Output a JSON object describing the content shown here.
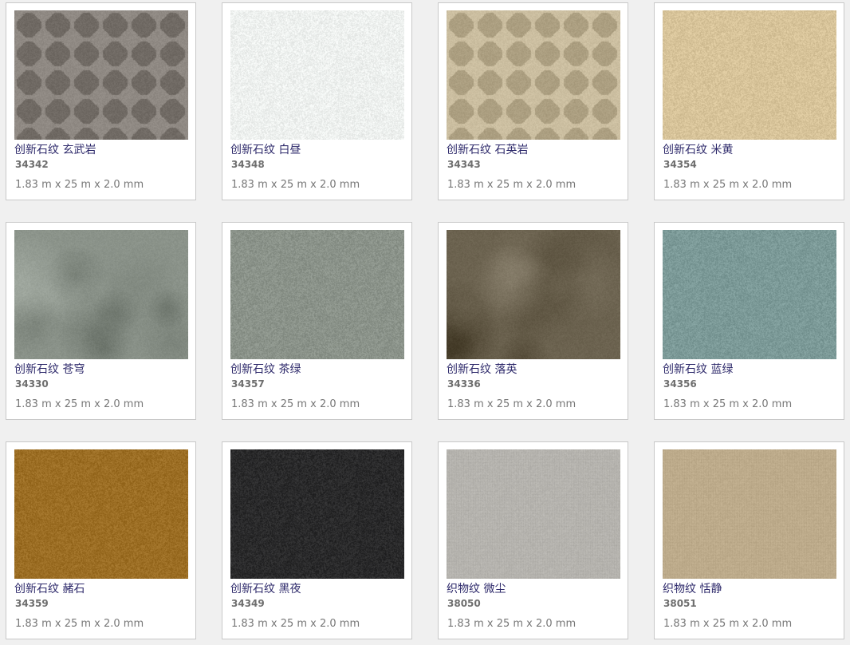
{
  "products": [
    {
      "name": "创新石纹 玄武岩",
      "code": "34342",
      "dims": "1.83 m x 25 m x 2.0 mm",
      "color": "#86807a",
      "pattern": "quatrefoil"
    },
    {
      "name": "创新石纹 白昼",
      "code": "34348",
      "dims": "1.83 m x 25 m x 2.0 mm",
      "color": "#eef1ef",
      "pattern": "speckle"
    },
    {
      "name": "创新石纹 石英岩",
      "code": "34343",
      "dims": "1.83 m x 25 m x 2.0 mm",
      "color": "#c2b597",
      "pattern": "quatrefoil"
    },
    {
      "name": "创新石纹 米黄",
      "code": "34354",
      "dims": "1.83 m x 25 m x 2.0 mm",
      "color": "#d8c49a",
      "pattern": "speckle"
    },
    {
      "name": "创新石纹 苍穹",
      "code": "34330",
      "dims": "1.83 m x 25 m x 2.0 mm",
      "color": "#8b938a",
      "pattern": "cloud"
    },
    {
      "name": "创新石纹 茶绿",
      "code": "34357",
      "dims": "1.83 m x 25 m x 2.0 mm",
      "color": "#8b938a",
      "pattern": "speckle"
    },
    {
      "name": "创新石纹 落英",
      "code": "34336",
      "dims": "1.83 m x 25 m x 2.0 mm",
      "color": "#6c6350",
      "pattern": "cloud"
    },
    {
      "name": "创新石纹 蓝绿",
      "code": "34356",
      "dims": "1.83 m x 25 m x 2.0 mm",
      "color": "#7c9a98",
      "pattern": "speckle"
    },
    {
      "name": "创新石纹 赭石",
      "code": "34359",
      "dims": "1.83 m x 25 m x 2.0 mm",
      "color": "#9c6e24",
      "pattern": "speckle"
    },
    {
      "name": "创新石纹 黑夜",
      "code": "34349",
      "dims": "1.83 m x 25 m x 2.0 mm",
      "color": "#2a2a2b",
      "pattern": "speckle"
    },
    {
      "name": "织物纹 微尘",
      "code": "38050",
      "dims": "1.83 m x 25 m x 2.0 mm",
      "color": "#b8b6b1",
      "pattern": "fabric"
    },
    {
      "name": "织物纹 恬静",
      "code": "38051",
      "dims": "1.83 m x 25 m x 2.0 mm",
      "color": "#c0ae8e",
      "pattern": "fabric"
    }
  ]
}
